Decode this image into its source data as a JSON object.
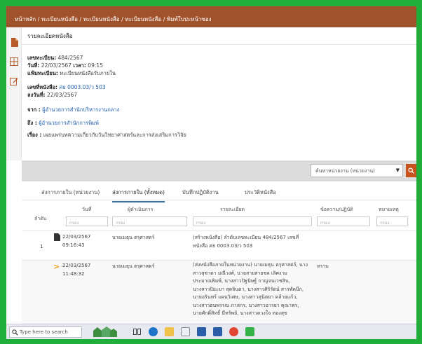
{
  "breadcrumb": "หน้าหลัก / ทะเบียนหนังสือ / ทะเบียนหนังสือ / ทะเบียนหนังสือ / พิมพ์ใบปะหน้าซอง",
  "detail": {
    "title": "รายละเอียดหนังสือ",
    "reg_no_label": "เลขทะเบียน:",
    "reg_no": "484/2567",
    "date_label": "วันที่:",
    "date": "22/03/2567",
    "time_label": "เวลา:",
    "time": "09:15",
    "reg_book_label": "แฟ้มทะเบียน:",
    "reg_book": "ทะเบียนหนังสือรับภายใน",
    "doc_no_label": "เลขที่หนังสือ:",
    "doc_no": "ศธ 0003.03/ว 503",
    "doc_date_label": "ลงวันที่:",
    "doc_date": "22/03/2567",
    "from_label": "จาก :",
    "from": "ผู้อำนวยการสำนักบริหารงานกลาง",
    "to_label": "ถึง :",
    "to": "ผู้อำนวยการสำนักการพิมพ์",
    "subject_label": "เรื่อง :",
    "subject": "เผยแพร่บทความเกี่ยวกับวันวิทยาศาสตร์และการส่งเสริมการวิจัย"
  },
  "filter": {
    "placeholder": "ค้นหาหน่วยงาน (หน่วยงาน)"
  },
  "tabs": [
    "ส่งการภายใน (หน่วยงาน)",
    "ส่งการภายใน (ทั้งหมด)",
    "บันทึกปฏิบัติงาน",
    "ประวัติหนังสือ"
  ],
  "table": {
    "headers": {
      "seq": "ลำดับ",
      "date": "วันที่",
      "operator": "ผู้ดำเนินการ",
      "details": "รายละเอียด",
      "status": "ข้อความ/ปฏิบัติ",
      "note": "หมายเหตุ"
    },
    "filter_placeholder": "กรอง",
    "rows": [
      {
        "seq": "1",
        "date": "22/03/2567",
        "time": "09:16:43",
        "operator": "นายเมธุน ตรุศาสตร์",
        "details": [
          "(สร้างหนังสือ) ลำดับเลขทะเบียน 484/2567 เลขที่",
          "หนังสือ ศธ 0003.03/ว 503"
        ],
        "status": ""
      },
      {
        "seq": "",
        "date": "22/03/2567",
        "time": "11:48:32",
        "operator": "นายเมธุน ตรุศาสตร์",
        "details": [
          "(ส่งหนังสือภายในหน่วยงาน) นายเมธุน ตรุศาสตร์, นาง",
          "สาวสุชาดา มณีวงศ์, นายสายสายชล เลิศงาม",
          "ประมาณพิมพ์, นางสาวปัฐนิษฐ์ กาญจนเวชสิน,",
          "นางสาวปิยะมา สุดจินดา, นางสาวศิริรัตน์ สารพัดนึก,",
          "นายอรินทร์ แผนวิเศษ, นางสาวสุนิตยา คล้ายแก้ว,",
          "นางสาวธนพรรณ ภาสกร, นางสาวอารยา คุณาพร,",
          "นายศักดิ์สิทธิ์ มีทรัพย์, นางสาวดวงใจ ทองสุข"
        ],
        "status": "ทราบ"
      }
    ]
  },
  "taskbar": {
    "search_placeholder": "Type here to search"
  },
  "colors": {
    "border_green": "#1fae3a",
    "header_brown": "#a0522d",
    "accent_orange": "#c8531c",
    "link_blue": "#1f5fae"
  },
  "icons": [
    "document-icon",
    "grid-icon",
    "edit-icon",
    "search-icon",
    "arrow-icon",
    "windows-search-icon",
    "taskview-icon",
    "edge-icon",
    "explorer-icon",
    "store-icon",
    "word-icon",
    "chrome-icon",
    "line-icon"
  ]
}
